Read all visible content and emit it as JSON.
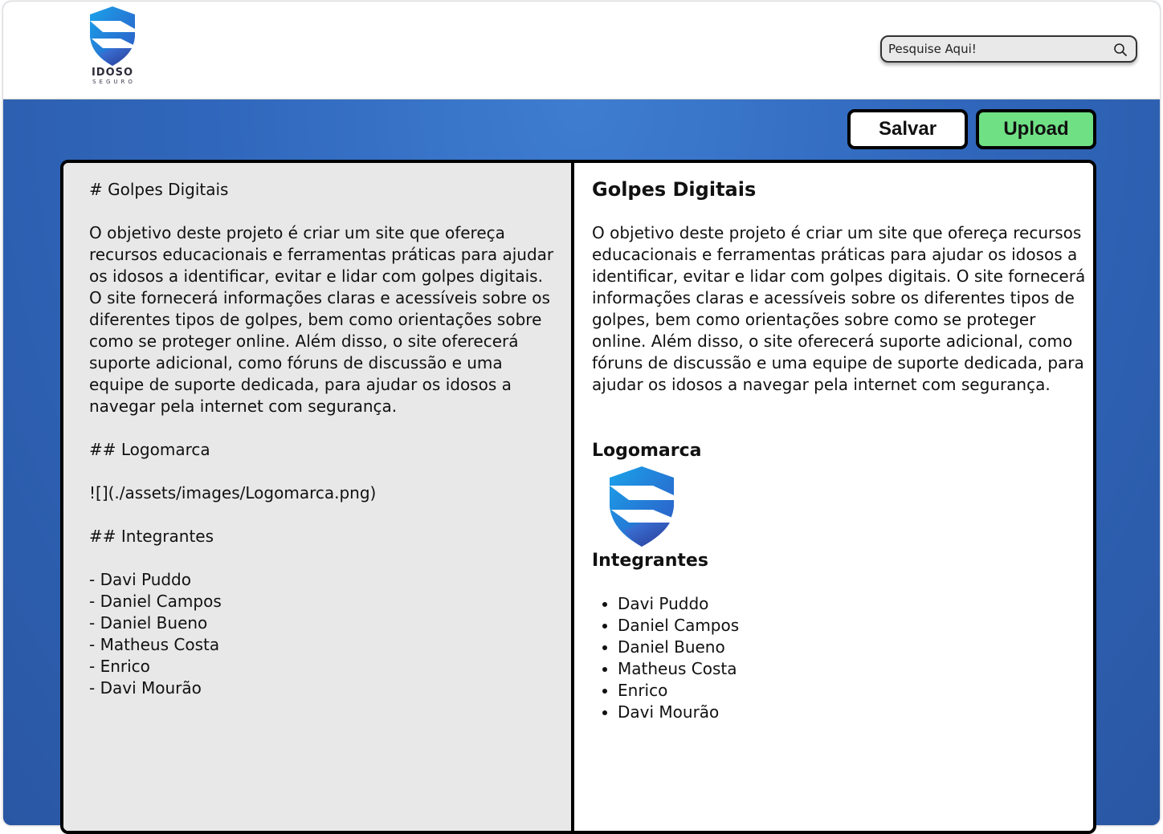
{
  "header": {
    "logo": {
      "name": "IDOSO",
      "tagline": "SEGURO",
      "icon": "shield-logo-icon"
    },
    "search": {
      "placeholder": "Pesquise Aqui!",
      "icon": "search-icon"
    }
  },
  "toolbar": {
    "save_label": "Salvar",
    "upload_label": "Upload",
    "upload_color": "#70e085"
  },
  "editor": {
    "markdown": "# Golpes Digitais\n\nO objetivo deste projeto é criar um site que ofereça recursos educacionais e ferramentas práticas para ajudar os idosos a identificar, evitar e lidar com golpes digitais. O site fornecerá informações claras e acessíveis sobre os diferentes tipos de golpes, bem como orientações sobre como se proteger online. Além disso, o site oferecerá suporte adicional, como fóruns de discussão e uma equipe de suporte dedicada, para ajudar os idosos a navegar pela internet com segurança.\n\n## Logomarca\n\n![](./assets/images/Logomarca.png)\n\n## Integrantes\n\n- Davi Puddo\n- Daniel Campos\n- Daniel Bueno\n- Matheus Costa\n- Enrico\n- Davi Mourão"
  },
  "preview": {
    "title": "Golpes Digitais",
    "paragraph": "O objetivo deste projeto é criar um site que ofereça recursos educacionais e ferramentas práticas para ajudar os idosos a identificar, evitar e lidar com golpes digitais. O site fornecerá informações claras e acessíveis sobre os diferentes tipos de golpes, bem como orientações sobre como se proteger online. Além disso, o site oferecerá suporte adicional, como fóruns de discussão e uma equipe de suporte dedicada, para ajudar os idosos a navegar pela internet com segurança.",
    "logo_heading": "Logomarca",
    "members_heading": "Integrantes",
    "members": [
      "Davi Puddo",
      "Daniel Campos",
      "Daniel Bueno",
      "Matheus Costa",
      "Enrico",
      "Davi Mourão"
    ]
  },
  "colors": {
    "background_blue": "#3067bc",
    "editor_bg": "#e8e8e8",
    "brand_blue": "#2f8fe0",
    "brand_navy": "#2a3c9a"
  }
}
